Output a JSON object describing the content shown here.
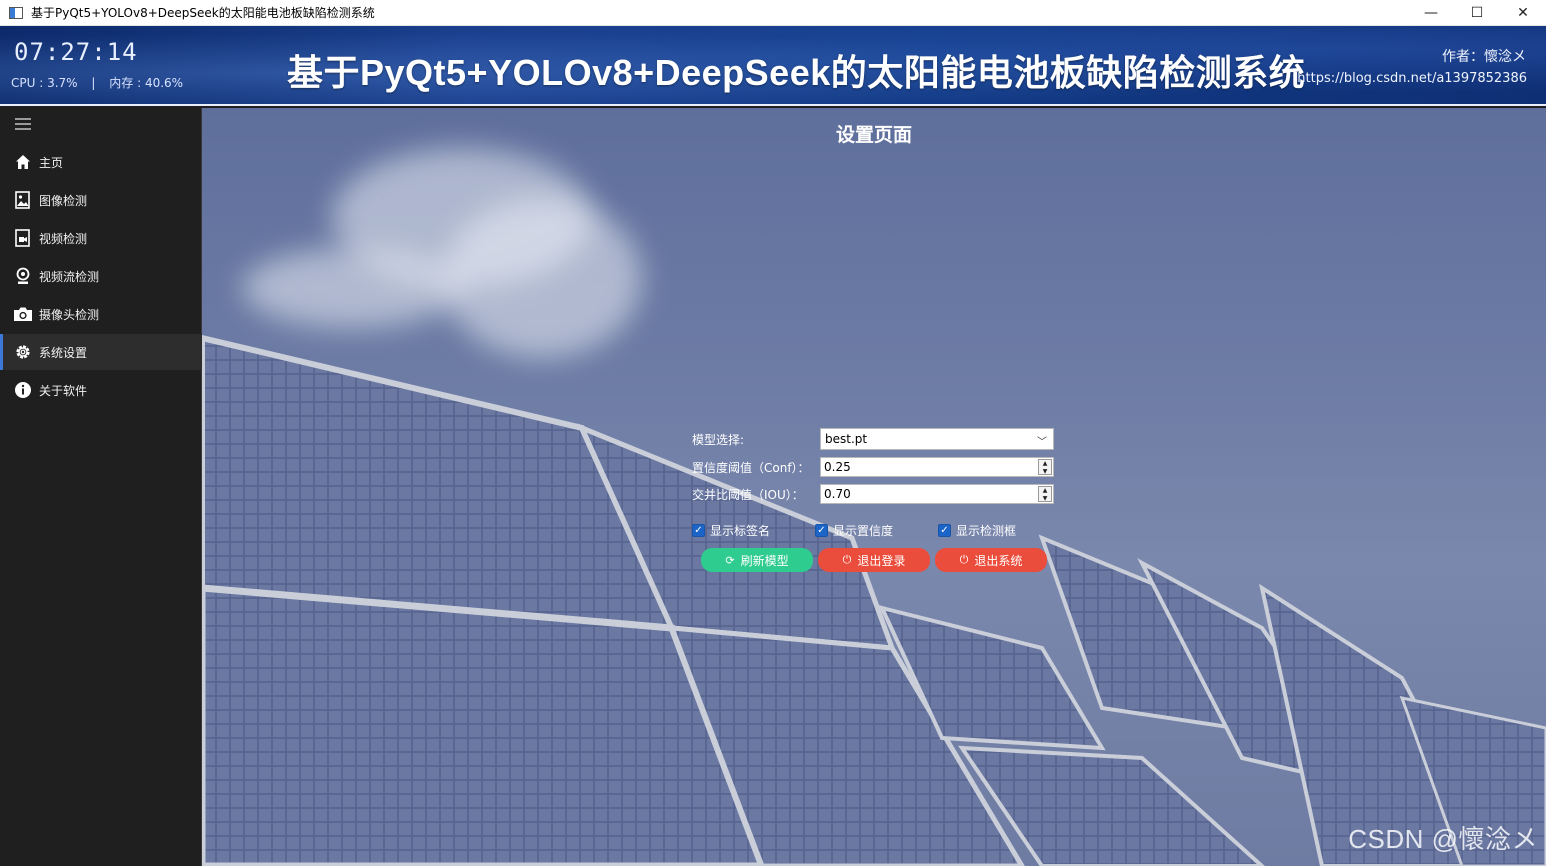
{
  "window": {
    "title": "基于PyQt5+YOLOv8+DeepSeek的太阳能电池板缺陷检测系统",
    "minimize": "—",
    "maximize": "☐",
    "close": "✕"
  },
  "header": {
    "clock": "07:27:14",
    "cpu": "CPU : 3.7%",
    "separator": "|",
    "memory": "内存 : 40.6%",
    "title": "基于PyQt5+YOLOv8+DeepSeek的太阳能电池板缺陷检测系统",
    "author": "作者：懷淰メ",
    "blog": "https://blog.csdn.net/a1397852386"
  },
  "sidebar": {
    "items": [
      {
        "label": "主页",
        "icon": "home-icon"
      },
      {
        "label": "图像检测",
        "icon": "image-icon"
      },
      {
        "label": "视频检测",
        "icon": "video-icon"
      },
      {
        "label": "视频流检测",
        "icon": "webcam-icon"
      },
      {
        "label": "摄像头检测",
        "icon": "camera-icon"
      },
      {
        "label": "系统设置",
        "icon": "gear-icon",
        "active": true
      },
      {
        "label": "关于软件",
        "icon": "info-icon"
      }
    ]
  },
  "settings": {
    "page_title": "设置页面",
    "model_label": "模型选择:",
    "model_value": "best.pt",
    "conf_label": "置信度阈值（Conf）：",
    "conf_value": "0.25",
    "iou_label": "交并比阈值（IOU）：",
    "iou_value": "0.70",
    "show_label": "显示标签名",
    "show_conf": "显示置信度",
    "show_box": "显示检测框",
    "refresh_button": "刷新模型",
    "logout_button": "退出登录",
    "exit_button": "退出系统"
  },
  "watermark": "CSDN @懷淰メ",
  "colors": {
    "accent_blue": "#1c64c8",
    "green_button": "#2ecc8f",
    "red_button": "#ea4d3c",
    "sidebar_bg": "#1f1f1f"
  }
}
